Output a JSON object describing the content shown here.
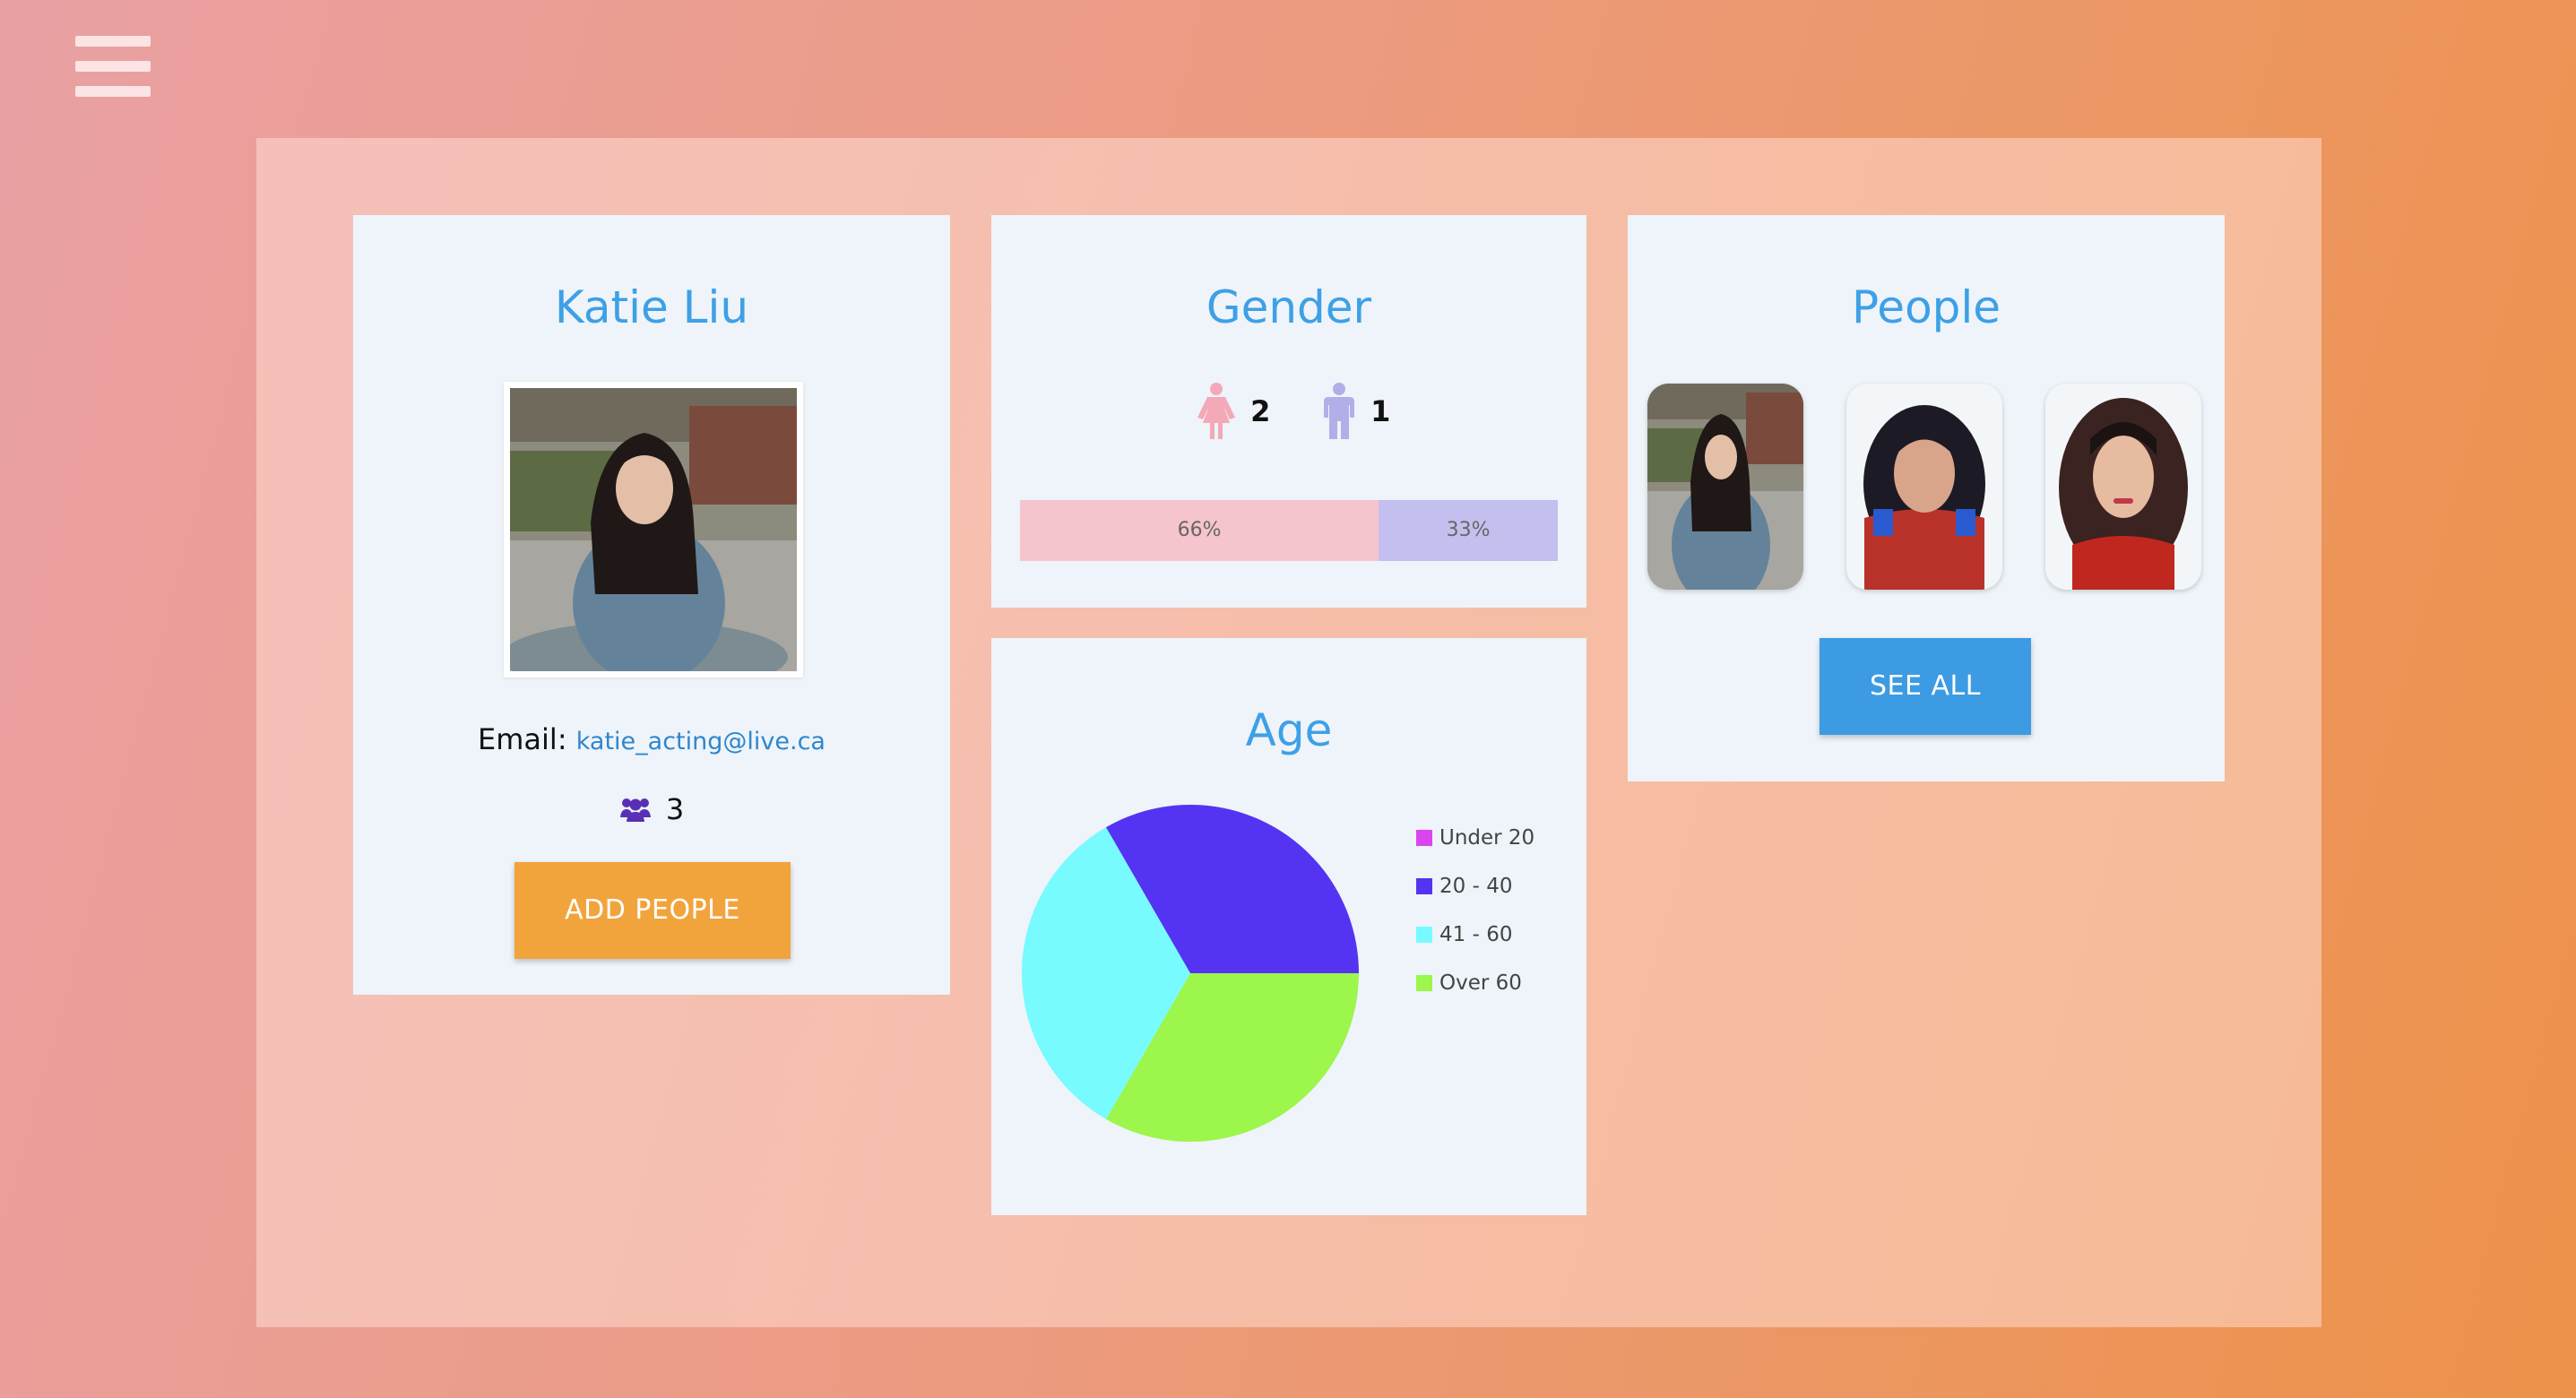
{
  "menu": {
    "icon": "hamburger-icon"
  },
  "profile": {
    "name": "Katie Liu",
    "email_label": "Email:",
    "email": "katie_acting@live.ca",
    "people_count": "3",
    "people_count_icon": "users-icon",
    "add_button": "ADD PEOPLE"
  },
  "gender": {
    "title": "Gender",
    "female_count": "2",
    "male_count": "1",
    "female_icon": "female-icon",
    "male_icon": "male-icon",
    "female_percent_label": "66%",
    "male_percent_label": "33%",
    "female_fraction": 0.667,
    "colors": {
      "female": "#f6c4cc",
      "male": "#c3c0ef",
      "female_icon": "#f4a9b8",
      "male_icon": "#b3aee8"
    }
  },
  "age": {
    "title": "Age",
    "legend": [
      "Under 20",
      "20 - 40",
      "41 - 60",
      "Over 60"
    ]
  },
  "chart_data": {
    "type": "pie",
    "title": "Age",
    "categories": [
      "Under 20",
      "20 - 40",
      "41 - 60",
      "Over 60"
    ],
    "values": [
      0,
      1,
      1,
      1
    ],
    "colors": [
      "#d946ef",
      "#5533f2",
      "#77fbff",
      "#9cf64b"
    ],
    "legend_position": "right"
  },
  "people": {
    "title": "People",
    "see_all_button": "SEE ALL"
  },
  "colors": {
    "accent_blue": "#3ea0e6",
    "button_orange": "#f2a43c",
    "button_blue": "#3c9be2",
    "card_bg": "#eef4f9"
  }
}
